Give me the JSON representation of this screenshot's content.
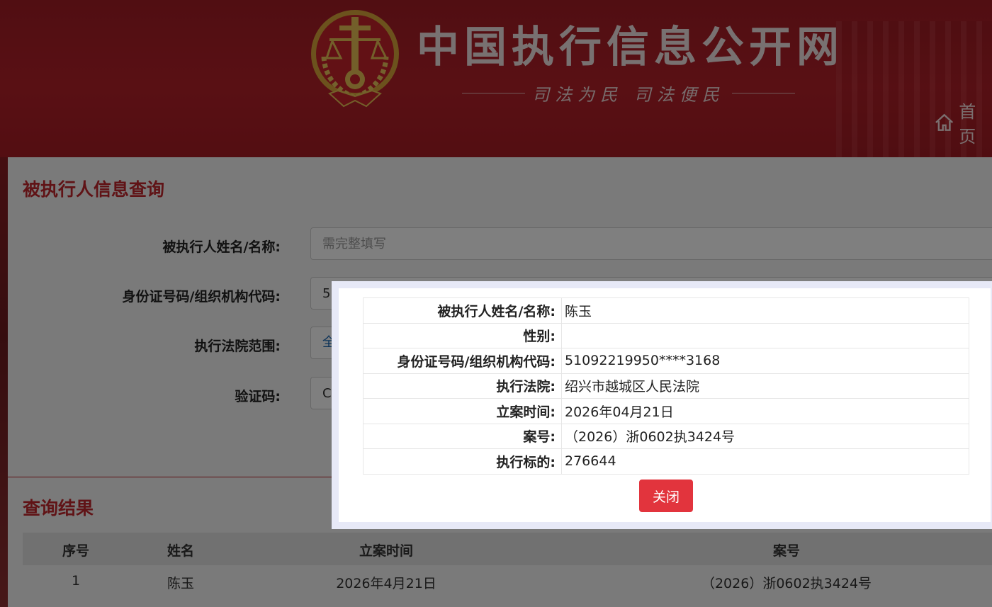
{
  "header": {
    "site_title": "中国执行信息公开网",
    "slogan": "司法为民 司法便民",
    "nav_home_label": "首页"
  },
  "search_form": {
    "title": "被执行人信息查询",
    "name_label": "被执行人姓名/名称:",
    "name_placeholder": "需完整填写",
    "id_label": "身份证号码/组织机构代码:",
    "id_value_partial": "5",
    "court_label": "执行法院范围:",
    "court_value_partial": "全",
    "captcha_label": "验证码:",
    "captcha_value_partial": "C"
  },
  "results": {
    "title": "查询结果",
    "columns": [
      "序号",
      "姓名",
      "立案时间",
      "案号"
    ],
    "rows": [
      [
        "1",
        "陈玉",
        "2026年4月21日",
        "（2026）浙0602执3424号"
      ]
    ]
  },
  "modal": {
    "fields": [
      {
        "label": "被执行人姓名/名称:",
        "value": "陈玉"
      },
      {
        "label": "性别:",
        "value": ""
      },
      {
        "label": "身份证号码/组织机构代码:",
        "value": "51092219950****3168"
      },
      {
        "label": "执行法院:",
        "value": "绍兴市越城区人民法院"
      },
      {
        "label": "立案时间:",
        "value": "2026年04月21日"
      },
      {
        "label": "案号:",
        "value": "（2026）浙0602执3424号"
      },
      {
        "label": "执行标的:",
        "value": "276644"
      }
    ],
    "close_label": "关闭"
  },
  "colors": {
    "brand_red": "#b32029",
    "accent_red": "#c1272d",
    "close_button": "#e2343d",
    "modal_border": "#e7e9f7"
  },
  "icons": [
    "court-emblem-icon",
    "home-icon"
  ]
}
